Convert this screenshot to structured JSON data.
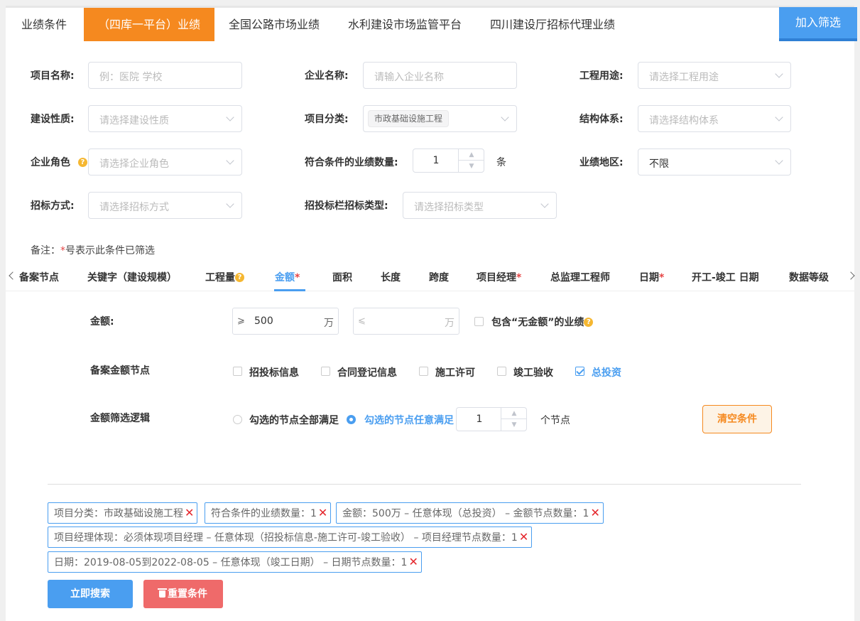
{
  "top_tabs": [
    "业绩条件",
    "（四库一平台）业绩",
    "全国公路市场业绩",
    "水利建设市场监管平台",
    "四川建设厅招标代理业绩"
  ],
  "add_filter": "加入筛选",
  "form": {
    "project_name": {
      "label": "项目名称:",
      "placeholder": "例：医院 学校"
    },
    "company_name": {
      "label": "企业名称:",
      "placeholder": "请输入企业名称"
    },
    "project_usage": {
      "label": "工程用途:",
      "placeholder": "请选择工程用途"
    },
    "build_nature": {
      "label": "建设性质:",
      "placeholder": "请选择建设性质"
    },
    "project_category": {
      "label": "项目分类:",
      "tag": "市政基础设施工程"
    },
    "structure": {
      "label": "结构体系:",
      "placeholder": "请选择结构体系"
    },
    "company_role": {
      "label": "企业角色",
      "placeholder": "请选择企业角色"
    },
    "count": {
      "label": "符合条件的业绩数量:",
      "value": "1",
      "unit": "条"
    },
    "region": {
      "label": "业绩地区:",
      "value": "不限"
    },
    "bid_method": {
      "label": "招标方式:",
      "placeholder": "请选择招标方式"
    },
    "bid_type": {
      "label": "招投标栏招标类型:",
      "placeholder": "请选择招标类型"
    }
  },
  "note": {
    "prefix": "备注：",
    "star": "*",
    "text": "号表示此条件已筛选"
  },
  "sub_tabs": [
    {
      "label": "备案节点",
      "req": ""
    },
    {
      "label": "关键字（建设规模）",
      "req": ""
    },
    {
      "label": "工程量",
      "req": ""
    },
    {
      "label": "金额",
      "req": "*"
    },
    {
      "label": "面积",
      "req": ""
    },
    {
      "label": "长度",
      "req": ""
    },
    {
      "label": "跨度",
      "req": ""
    },
    {
      "label": "项目经理",
      "req": "*"
    },
    {
      "label": "总监理工程师",
      "req": ""
    },
    {
      "label": "日期",
      "req": "*"
    },
    {
      "label": "开工-竣工 日期",
      "req": ""
    },
    {
      "label": "数据等级",
      "req": ""
    }
  ],
  "amount": {
    "label": "金额:",
    "ge_prefix": "⩾",
    "ge_value": "500",
    "le_prefix": "⩽",
    "unit": "万",
    "include_label": "包含“无金额”的业绩"
  },
  "nodes": {
    "label": "备案金额节点",
    "items": [
      {
        "label": "招投标信息",
        "checked": false
      },
      {
        "label": "合同登记信息",
        "checked": false
      },
      {
        "label": "施工许可",
        "checked": false
      },
      {
        "label": "竣工验收",
        "checked": false
      },
      {
        "label": "总投资",
        "checked": true
      }
    ]
  },
  "logic": {
    "label": "金额筛选逻辑",
    "all_label": "勾选的节点全部满足",
    "any_label": "勾选的节点任意满足",
    "count": "1",
    "unit": "个节点"
  },
  "clear_button": "清空条件",
  "chips": [
    "项目分类：市政基础设施工程",
    "符合条件的业绩数量：1",
    "金额：500万 – 任意体现（总投资） – 金额节点数量：1",
    "项目经理体现：必须体现项目经理 – 任意体现（招投标信息-施工许可-竣工验收） – 项目经理节点数量：1",
    "日期：2019-08-05到2022-08-05 – 任意体现（竣工日期） – 日期节点数量：1"
  ],
  "chip_close": "✕",
  "search_button": "立即搜索",
  "reset_button": "重置条件",
  "colors": {
    "accent_orange": "#f5891f",
    "accent_blue": "#4a9ef0",
    "danger_red": "#ef6a6a"
  }
}
